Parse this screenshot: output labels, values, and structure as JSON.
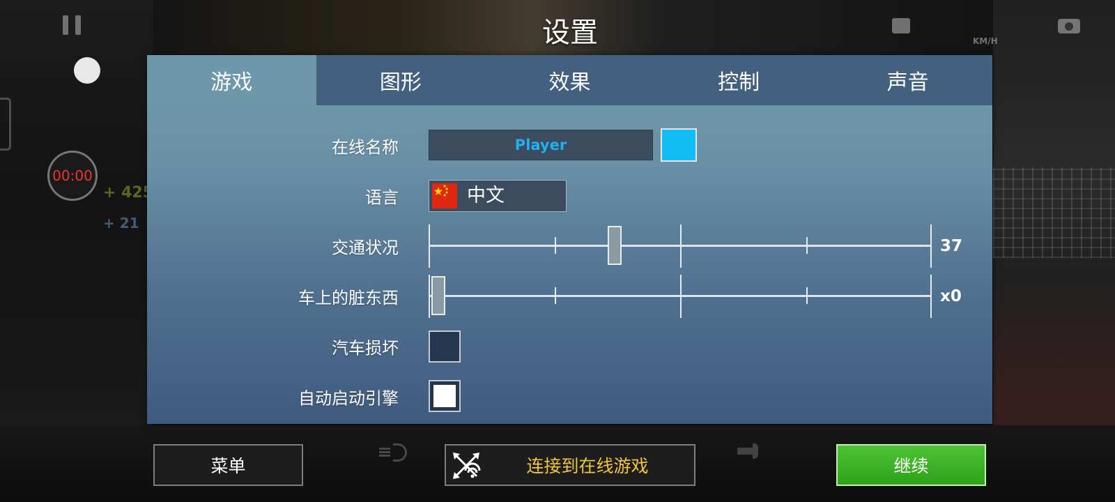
{
  "title": "设置",
  "hud": {
    "timer": "00:00",
    "stat_money": "+ 425",
    "stat_count": "+ 21",
    "speed_unit": "KM/H"
  },
  "tabs": [
    {
      "label": "游戏",
      "active": true
    },
    {
      "label": "图形",
      "active": false
    },
    {
      "label": "效果",
      "active": false
    },
    {
      "label": "控制",
      "active": false
    },
    {
      "label": "声音",
      "active": false
    }
  ],
  "settings": {
    "online_name": {
      "label": "在线名称",
      "value": "Player",
      "color": "#12bcf5"
    },
    "language": {
      "label": "语言",
      "value": "中文",
      "flag": "china-flag-icon"
    },
    "traffic": {
      "label": "交通状况",
      "value": "37",
      "fraction": 0.37
    },
    "dirt": {
      "label": "车上的脏东西",
      "value": "x0",
      "fraction": 0.02
    },
    "car_damage": {
      "label": "汽车损坏",
      "checked": false
    },
    "auto_start_engine": {
      "label": "自动启动引擎",
      "checked": true
    }
  },
  "buttons": {
    "menu": "菜单",
    "connect_online": "连接到在线游戏",
    "continue": "继续"
  },
  "colors": {
    "accent_blue": "#22b0ef",
    "online_yellow": "#f0c63a",
    "continue_green": "#3fb02a",
    "tab_bar": "#43607f",
    "tab_active": "#6d98aa",
    "timer_red": "#ee3333"
  }
}
